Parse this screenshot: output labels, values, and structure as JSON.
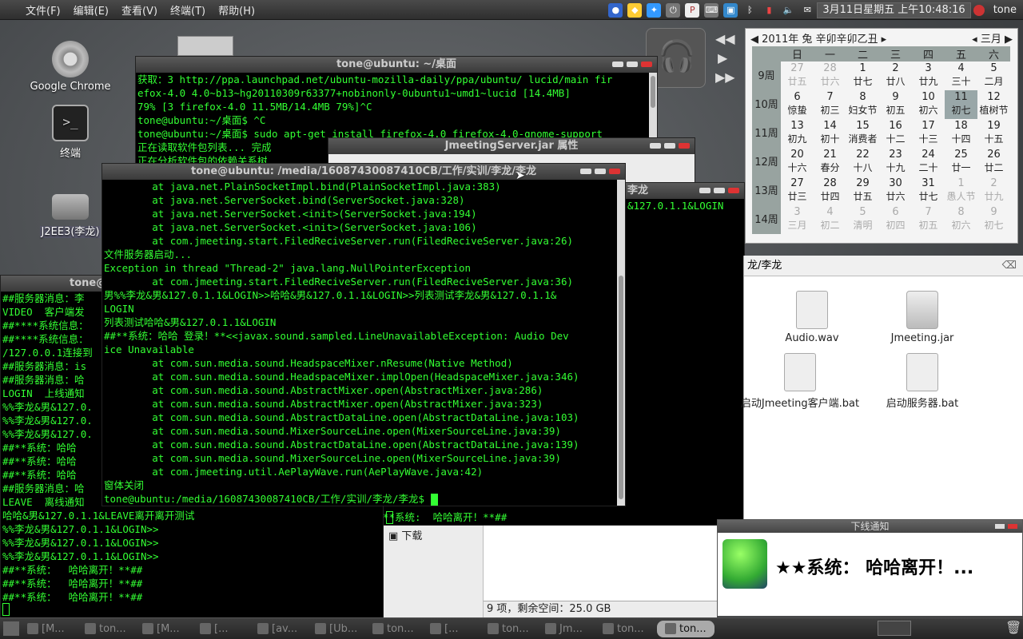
{
  "top_panel": {
    "menus": [
      "文件(F)",
      "编辑(E)",
      "查看(V)",
      "终端(T)",
      "帮助(H)"
    ],
    "clock": "3月11日星期五 上午10:48:16",
    "user": "tone"
  },
  "desktop_icons": [
    {
      "label": "Google Chrome"
    },
    {
      "label": "终端"
    },
    {
      "label": "J2EE3(李龙)"
    }
  ],
  "back_terminal": {
    "title": "tone@ubuntu: ~/桌面",
    "lines": [
      "获取：3 http://ppa.launchpad.net/ubuntu-mozilla-daily/ppa/ubuntu/ lucid/main fir",
      "efox-4.0 4.0~b13~hg20110309r63377+nobinonly-0ubuntu1~umd1~lucid [14.4MB]",
      "79% [3 firefox-4.0 11.5MB/14.4MB 79%]^C",
      "tone@ubuntu:~/桌面$ ^C",
      "tone@ubuntu:~/桌面$ sudo apt-get install firefox-4.0 firefox-4.0-gnome-support",
      "正在读取软件包列表... 完成",
      "正在分析软件包的依赖关系树"
    ]
  },
  "jar_props": {
    "title": "JmeetingServer.jar 属性"
  },
  "server_win": {
    "title": "李龙",
    "line": "&127.0.1.1&LOGIN",
    "bottom": "**系统:  哈哈离开！**##"
  },
  "left_terminal": {
    "title": "tone@",
    "lines": [
      "##服务器消息：李",
      "VIDEO  客户端发",
      "##****系统信息：",
      "##****系统信息：",
      "/127.0.0.1连接到",
      "##服务器消息：is",
      "##服务器消息：哈",
      "LOGIN  上线通知",
      "%%李龙&男&127.0.",
      "%%李龙&男&127.0.",
      "%%李龙&男&127.0.",
      "##**系统：哈哈 ",
      "##**系统：哈哈 ",
      "##**系统：哈哈 ",
      "##服务器消息：哈",
      "LEAVE  离线通知",
      "哈哈&男&127.0.1.1&LEAVE离开离开测试",
      "%%李龙&男&127.0.1.1&LOGIN>>",
      "%%李龙&男&127.0.1.1&LOGIN>>",
      "%%李龙&男&127.0.1.1&LOGIN>>",
      "##**系统：  哈哈离开！**##",
      "##**系统：  哈哈离开！**##",
      "##**系统：  哈哈离开！**##"
    ]
  },
  "main_terminal": {
    "title": "tone@ubuntu: /media/16087430087410CB/工作/实训/李龙/李龙",
    "lines": [
      "        at java.net.PlainSocketImpl.bind(PlainSocketImpl.java:383)",
      "        at java.net.ServerSocket.bind(ServerSocket.java:328)",
      "        at java.net.ServerSocket.<init>(ServerSocket.java:194)",
      "        at java.net.ServerSocket.<init>(ServerSocket.java:106)",
      "        at com.jmeeting.start.FiledReciveServer.run(FiledReciveServer.java:26)",
      "文件服务器启动...",
      "Exception in thread \"Thread-2\" java.lang.NullPointerException",
      "        at com.jmeeting.start.FiledReciveServer.run(FiledReciveServer.java:36)",
      "男%%李龙&男&127.0.1.1&LOGIN>>哈哈&男&127.0.1.1&LOGIN>>列表测试李龙&男&127.0.1.1&",
      "LOGIN",
      "列表测试哈哈&男&127.0.1.1&LOGIN",
      "##**系统：哈哈 登录！**<<javax.sound.sampled.LineUnavailableException: Audio Dev",
      "ice Unavailable",
      "        at com.sun.media.sound.HeadspaceMixer.nResume(Native Method)",
      "        at com.sun.media.sound.HeadspaceMixer.implOpen(HeadspaceMixer.java:346)",
      "        at com.sun.media.sound.AbstractMixer.open(AbstractMixer.java:286)",
      "        at com.sun.media.sound.AbstractMixer.open(AbstractMixer.java:323)",
      "        at com.sun.media.sound.AbstractDataLine.open(AbstractDataLine.java:103)",
      "        at com.sun.media.sound.MixerSourceLine.open(MixerSourceLine.java:39)",
      "        at com.sun.media.sound.AbstractDataLine.open(AbstractDataLine.java:139)",
      "        at com.sun.media.sound.MixerSourceLine.open(MixerSourceLine.java:39)",
      "        at com.jmeeting.util.AePlayWave.run(AePlayWave.java:42)",
      "窗体关闭",
      "tone@ubuntu:/media/16087430087410CB/工作/实训/李龙/李龙$ "
    ]
  },
  "calendar": {
    "year_label": "2011年 兔 辛卯辛卯乙丑",
    "month_label": "三月",
    "weekdays": [
      "日",
      "一",
      "二",
      "三",
      "四",
      "五",
      "六"
    ],
    "weeks": [
      {
        "wk": "9周",
        "days": [
          [
            "27",
            "廿五",
            1
          ],
          [
            "28",
            "廿六",
            1
          ],
          [
            "1",
            "廿七",
            0
          ],
          [
            "2",
            "廿八",
            0
          ],
          [
            "3",
            "廿九",
            0
          ],
          [
            "4",
            "三十",
            0
          ],
          [
            "5",
            "二月",
            0
          ]
        ]
      },
      {
        "wk": "10周",
        "days": [
          [
            "6",
            "惊蛰",
            0
          ],
          [
            "7",
            "初三",
            0
          ],
          [
            "8",
            "妇女节",
            0
          ],
          [
            "9",
            "初五",
            0
          ],
          [
            "10",
            "初六",
            0
          ],
          [
            "11",
            "初七",
            2
          ],
          [
            "12",
            "植树节",
            0
          ]
        ]
      },
      {
        "wk": "11周",
        "days": [
          [
            "13",
            "初九",
            0
          ],
          [
            "14",
            "初十",
            0
          ],
          [
            "15",
            "消费者",
            0
          ],
          [
            "16",
            "十二",
            0
          ],
          [
            "17",
            "十三",
            0
          ],
          [
            "18",
            "十四",
            0
          ],
          [
            "19",
            "十五",
            0
          ]
        ]
      },
      {
        "wk": "12周",
        "days": [
          [
            "20",
            "十六",
            0
          ],
          [
            "21",
            "春分",
            0
          ],
          [
            "22",
            "十八",
            0
          ],
          [
            "23",
            "十九",
            0
          ],
          [
            "24",
            "二十",
            0
          ],
          [
            "25",
            "廿一",
            0
          ],
          [
            "26",
            "廿二",
            0
          ]
        ]
      },
      {
        "wk": "13周",
        "days": [
          [
            "27",
            "廿三",
            0
          ],
          [
            "28",
            "廿四",
            0
          ],
          [
            "29",
            "廿五",
            0
          ],
          [
            "30",
            "廿六",
            0
          ],
          [
            "31",
            "廿七",
            0
          ],
          [
            "1",
            "愚人节",
            1
          ],
          [
            "2",
            "廿九",
            1
          ]
        ]
      },
      {
        "wk": "14周",
        "days": [
          [
            "3",
            "三月",
            1
          ],
          [
            "4",
            "初二",
            1
          ],
          [
            "5",
            "清明",
            1
          ],
          [
            "6",
            "初四",
            1
          ],
          [
            "7",
            "初五",
            1
          ],
          [
            "8",
            "初六",
            1
          ],
          [
            "9",
            "初七",
            1
          ]
        ]
      }
    ]
  },
  "file_manager": {
    "path": "龙/李龙",
    "files": [
      "Audio.wav",
      "Jmeeting.jar",
      "启动Jmeeting客户端.bat",
      "启动服务器.bat"
    ],
    "sidebar_item": "下载",
    "status": "9 项，剩余空间：25.0 GB"
  },
  "notification": {
    "title": "下线通知",
    "message": "★★系统：  哈哈离开！..."
  },
  "taskbar": [
    {
      "label": "[M...",
      "active": false
    },
    {
      "label": "ton...",
      "active": false
    },
    {
      "label": "[M...",
      "active": false
    },
    {
      "label": "[...",
      "active": false
    },
    {
      "label": "[av...",
      "active": false
    },
    {
      "label": "[Ub...",
      "active": false
    },
    {
      "label": "ton...",
      "active": false
    },
    {
      "label": "[...",
      "active": false
    },
    {
      "label": "ton...",
      "active": false
    },
    {
      "label": "Jm...",
      "active": false
    },
    {
      "label": "ton...",
      "active": false
    },
    {
      "label": "ton...",
      "active": true
    }
  ]
}
